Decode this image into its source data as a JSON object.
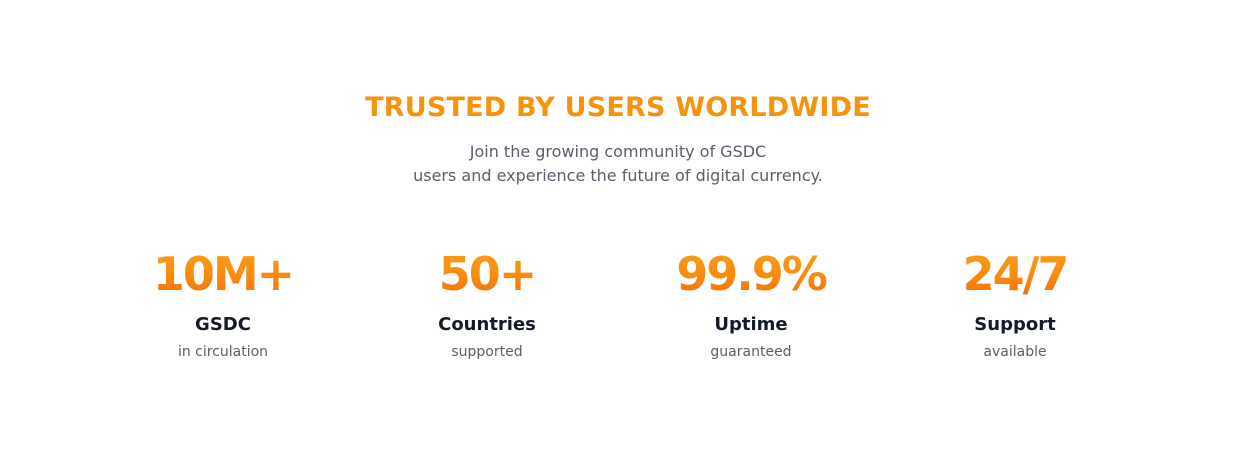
{
  "section": {
    "heading": "TRUSTED BY USERS WORLDWIDE",
    "subtitle_line1": "Join the growing community of GSDC",
    "subtitle_line2": "users and experience the future of digital currency."
  },
  "stats": [
    {
      "value": "10M+",
      "label": "GSDC",
      "sub": "in circulation"
    },
    {
      "value": "50+",
      "label": "Countries",
      "sub": "supported"
    },
    {
      "value": "99.9%",
      "label": "Uptime",
      "sub": "guaranteed"
    },
    {
      "value": "24/7",
      "label": "Support",
      "sub": "available"
    }
  ],
  "colors": {
    "accent": "#f5930d",
    "gradient_top": "#f7a21a",
    "gradient_bottom": "#f26a0b",
    "label": "#151a2b",
    "muted": "#5b5f6b"
  }
}
